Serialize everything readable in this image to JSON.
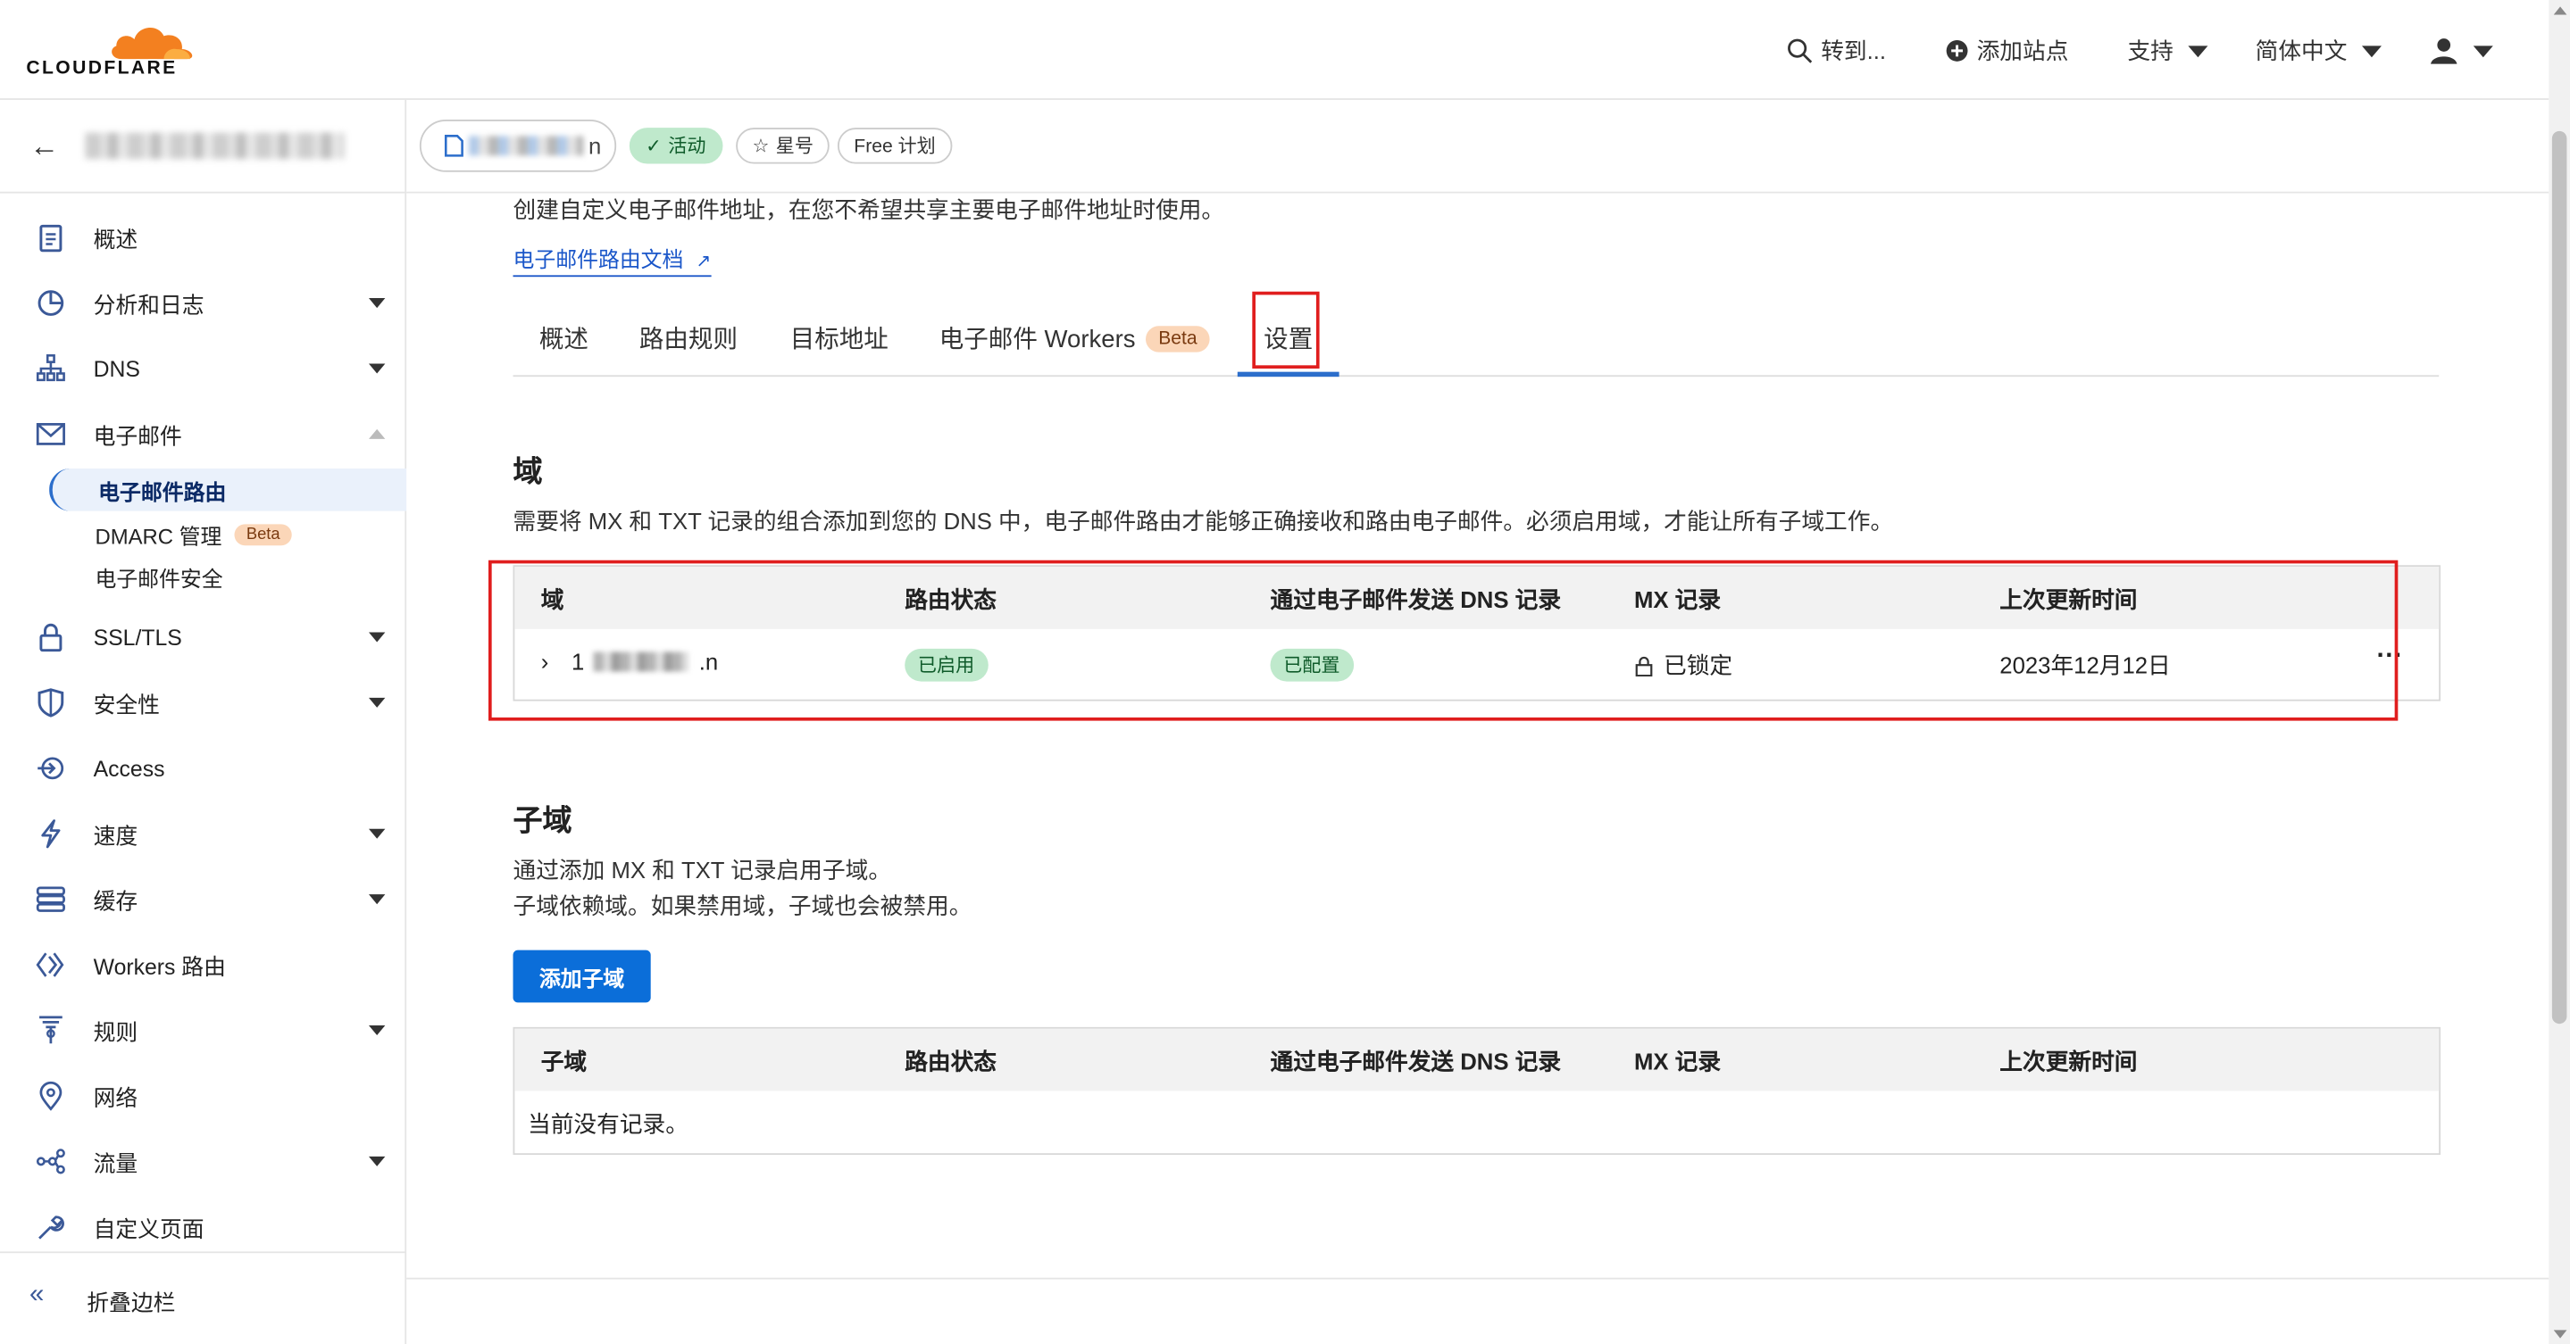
{
  "brand": {
    "name": "CLOUDFLARE",
    "logo_color": "#f38020"
  },
  "topbar": {
    "goto": "转到...",
    "add_site": "添加站点",
    "support": "支持",
    "language": "简体中文"
  },
  "sidebar": {
    "items": [
      {
        "label": "概述",
        "icon": "document-icon",
        "has_caret": false
      },
      {
        "label": "分析和日志",
        "icon": "chart-icon",
        "has_caret": true
      },
      {
        "label": "DNS",
        "icon": "network-icon",
        "has_caret": true
      },
      {
        "label": "电子邮件",
        "icon": "mail-icon",
        "has_caret": true
      },
      {
        "label": "SSL/TLS",
        "icon": "lock-icon",
        "has_caret": true
      },
      {
        "label": "安全性",
        "icon": "shield-icon",
        "has_caret": true
      },
      {
        "label": "Access",
        "icon": "access-icon",
        "has_caret": false
      },
      {
        "label": "速度",
        "icon": "bolt-icon",
        "has_caret": true
      },
      {
        "label": "缓存",
        "icon": "cache-icon",
        "has_caret": true
      },
      {
        "label": "Workers 路由",
        "icon": "workers-icon",
        "has_caret": false
      },
      {
        "label": "规则",
        "icon": "rules-icon",
        "has_caret": true
      },
      {
        "label": "网络",
        "icon": "location-icon",
        "has_caret": false
      },
      {
        "label": "流量",
        "icon": "traffic-icon",
        "has_caret": true
      },
      {
        "label": "自定义页面",
        "icon": "wrench-icon",
        "has_caret": false
      }
    ],
    "email_sub": [
      {
        "label": "电子邮件路由"
      },
      {
        "label": "DMARC 管理",
        "badge": "Beta"
      },
      {
        "label": "电子邮件安全"
      }
    ],
    "collapse_label": "折叠边栏"
  },
  "zone_header": {
    "zone_suffix": "n",
    "status": "活动",
    "star": "星号",
    "plan": "Free 计划"
  },
  "main": {
    "description": "创建自定义电子邮件地址，在您不希望共享主要电子邮件地址时使用。",
    "doc_link": "电子邮件路由文档",
    "tabs": [
      {
        "label": "概述"
      },
      {
        "label": "路由规则"
      },
      {
        "label": "目标地址"
      },
      {
        "label": "电子邮件 Workers",
        "badge": "Beta"
      },
      {
        "label": "设置"
      }
    ],
    "domain_section": {
      "title": "域",
      "text": "需要将 MX 和 TXT 记录的组合添加到您的 DNS 中，电子邮件路由才能够正确接收和路由电子邮件。必须启用域，才能让所有子域工作。",
      "columns": [
        "域",
        "路由状态",
        "通过电子邮件发送 DNS 记录",
        "MX 记录",
        "上次更新时间"
      ],
      "rows": [
        {
          "domain_suffix": ".n",
          "routing": "已启用",
          "dns": "已配置",
          "mx": "已锁定",
          "updated": "2023年12月12日"
        }
      ]
    },
    "subdomain_section": {
      "title": "子域",
      "text1": "通过添加 MX 和 TXT 记录启用子域。",
      "text2": "子域依赖域。如果禁用域，子域也会被禁用。",
      "add_button": "添加子域",
      "columns": [
        "子域",
        "路由状态",
        "通过电子邮件发送 DNS 记录",
        "MX 记录",
        "上次更新时间"
      ],
      "empty": "当前没有记录。"
    }
  }
}
